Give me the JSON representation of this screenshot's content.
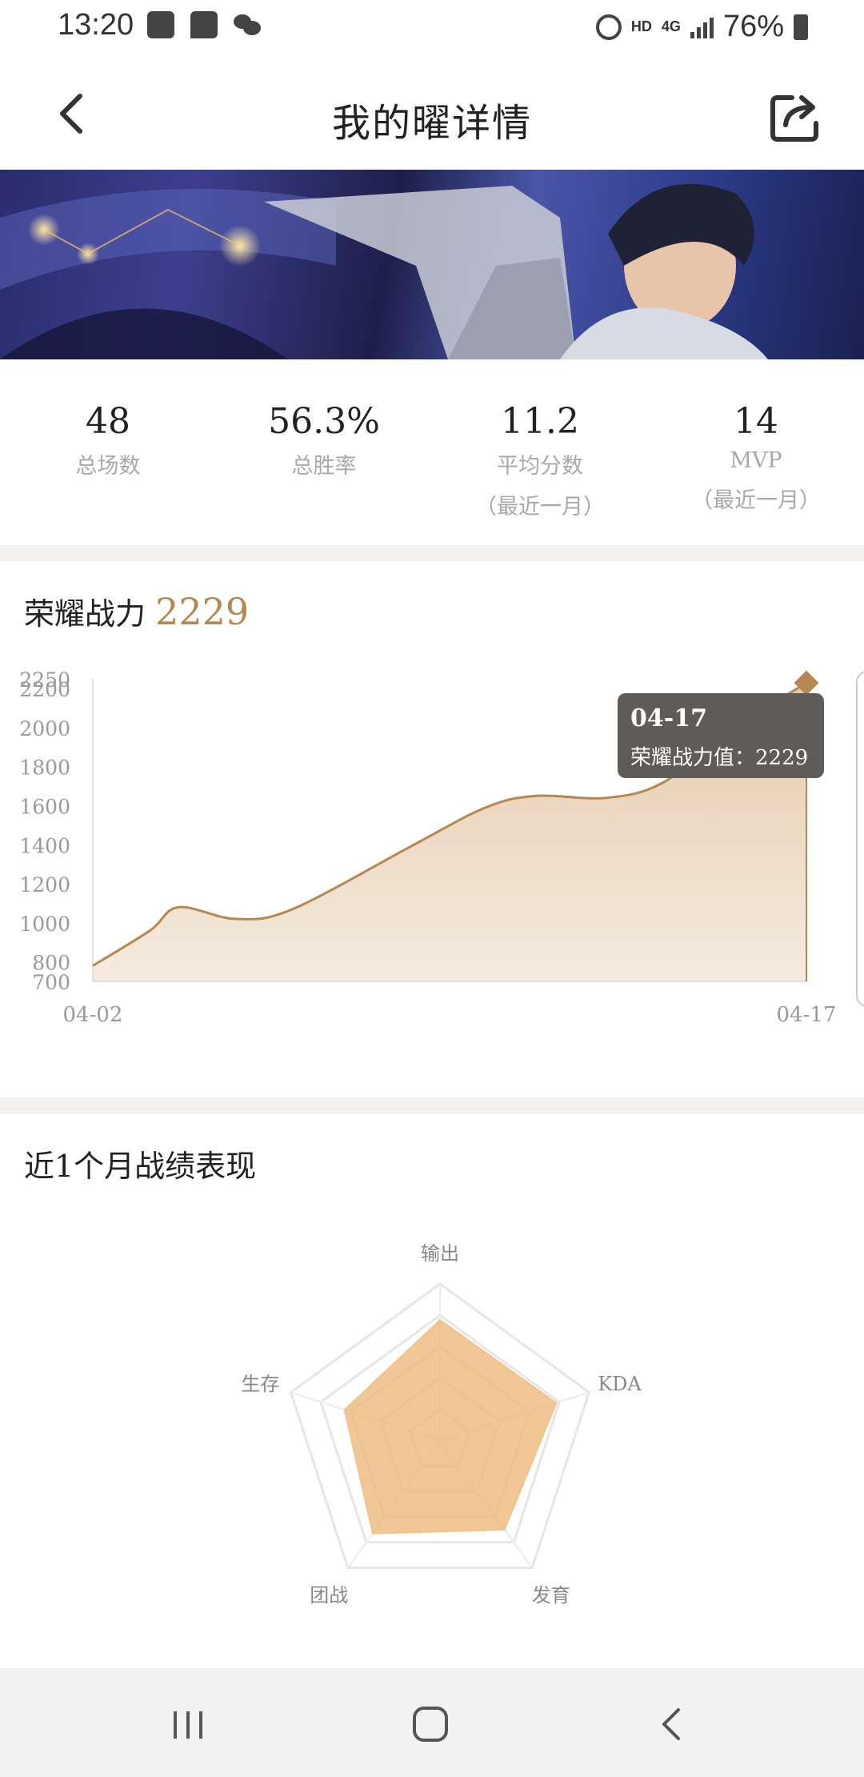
{
  "status_bar": {
    "time": "13:20",
    "hd_label": "HD",
    "network_label": "4G",
    "battery_text": "76%"
  },
  "header": {
    "title": "我的曜详情",
    "back_icon": "chevron-left-icon",
    "share_icon": "share-icon"
  },
  "stats": [
    {
      "value": "48",
      "label": "总场数",
      "sub": ""
    },
    {
      "value": "56.3%",
      "label": "总胜率",
      "sub": ""
    },
    {
      "value": "11.2",
      "label": "平均分数",
      "sub": "（最近一月）"
    },
    {
      "value": "14",
      "label": "MVP",
      "sub": "（最近一月）"
    }
  ],
  "power": {
    "label": "荣耀战力",
    "value": "2229",
    "accent_color": "#b8874f",
    "tooltip_date": "04-17",
    "tooltip_text": "荣耀战力值：2229"
  },
  "chart_data": [
    {
      "type": "area",
      "x_labels": [
        "04-02",
        "04-17"
      ],
      "y_ticks": [
        700,
        800,
        1000,
        1200,
        1400,
        1600,
        1800,
        2000,
        2200,
        2250
      ],
      "ylim": [
        700,
        2250
      ],
      "points": [
        {
          "x": 0.0,
          "y": 780
        },
        {
          "x": 0.08,
          "y": 960
        },
        {
          "x": 0.12,
          "y": 1080
        },
        {
          "x": 0.2,
          "y": 1020
        },
        {
          "x": 0.28,
          "y": 1070
        },
        {
          "x": 0.45,
          "y": 1400
        },
        {
          "x": 0.55,
          "y": 1590
        },
        {
          "x": 0.62,
          "y": 1650
        },
        {
          "x": 0.72,
          "y": 1640
        },
        {
          "x": 0.8,
          "y": 1720
        },
        {
          "x": 0.9,
          "y": 2000
        },
        {
          "x": 1.0,
          "y": 2229
        }
      ],
      "line_color": "#b8874f",
      "fill_color": "#e3c7a6"
    },
    {
      "type": "radar",
      "axes": [
        "输出",
        "KDA",
        "发育",
        "团战",
        "生存"
      ],
      "values": [
        0.77,
        0.78,
        0.7,
        0.73,
        0.64
      ],
      "fill_color": "#eeb97a"
    }
  ],
  "performance": {
    "title": "近1个月战绩表现"
  },
  "nav": {
    "recent_icon": "recent-apps-icon",
    "home_icon": "home-icon",
    "back_icon": "back-icon"
  }
}
